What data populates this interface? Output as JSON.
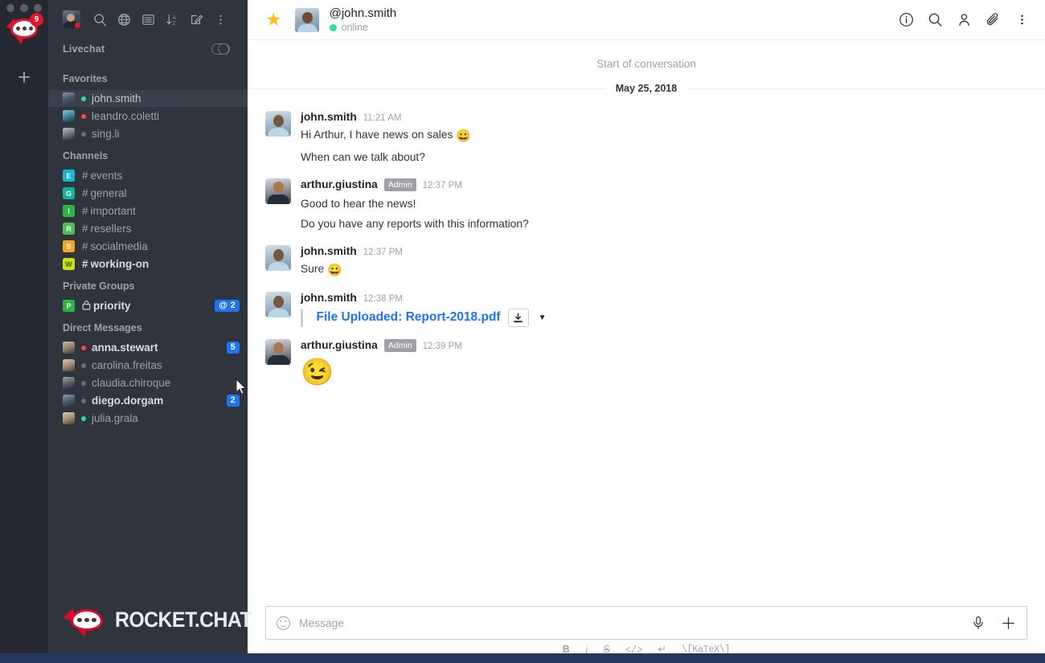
{
  "rail": {
    "app_badge": "9",
    "add_label": "+",
    "traffic_lights": [
      "close",
      "minimize",
      "zoom"
    ]
  },
  "sidebar": {
    "toolbar": [
      {
        "name": "user-avatar",
        "label": "avatar"
      },
      {
        "name": "search-icon",
        "label": "Search"
      },
      {
        "name": "globe-icon",
        "label": "Directory"
      },
      {
        "name": "list-icon",
        "label": "Discussions"
      },
      {
        "name": "sort-az-icon",
        "label": "Sort"
      },
      {
        "name": "pencil-icon",
        "label": "Create new"
      },
      {
        "name": "kebab-menu-icon",
        "label": "Options"
      }
    ],
    "livechat": {
      "label": "Livechat",
      "toggle_on": true
    },
    "sections": [
      {
        "title": "Favorites",
        "items": [
          {
            "name": "john.smith",
            "type": "dm",
            "status": "green",
            "active": true,
            "badge": "",
            "avatar": "ph1"
          },
          {
            "name": "leandro.coletti",
            "type": "dm",
            "status": "red",
            "active": false,
            "badge": "",
            "avatar": "ph2"
          },
          {
            "name": "sing.li",
            "type": "dm",
            "status": "grey",
            "active": false,
            "badge": "",
            "avatar": "ph3"
          }
        ]
      },
      {
        "title": "Channels",
        "items": [
          {
            "name": "events",
            "type": "channel",
            "initial": "E",
            "color": "#13b9cf",
            "badge": "",
            "bold": false
          },
          {
            "name": "general",
            "type": "channel",
            "initial": "G",
            "color": "#13b599",
            "badge": "",
            "bold": false
          },
          {
            "name": "important",
            "type": "channel",
            "initial": "I",
            "color": "#2fb344",
            "badge": "",
            "bold": false
          },
          {
            "name": "resellers",
            "type": "channel",
            "initial": "R",
            "color": "#4fc04f",
            "badge": "",
            "bold": false
          },
          {
            "name": "socialmedia",
            "type": "channel",
            "initial": "S",
            "color": "#f5a623",
            "badge": "",
            "bold": false
          },
          {
            "name": "working-on",
            "type": "channel",
            "initial": "W",
            "color": "#c6e411",
            "badge": "",
            "bold": true
          }
        ]
      },
      {
        "title": "Private Groups",
        "items": [
          {
            "name": "priority",
            "type": "group",
            "initial": "P",
            "color": "#2fb344",
            "badge": "@ 2",
            "bold": true
          }
        ]
      },
      {
        "title": "Direct Messages",
        "items": [
          {
            "name": "anna.stewart",
            "type": "dm",
            "status": "red",
            "badge": "5",
            "bold": true,
            "avatar": "ph4"
          },
          {
            "name": "carolina.freitas",
            "type": "dm",
            "status": "grey",
            "badge": "",
            "bold": false,
            "avatar": "ph5"
          },
          {
            "name": "claudia.chiroque",
            "type": "dm",
            "status": "grey",
            "badge": "",
            "bold": false,
            "avatar": "ph6"
          },
          {
            "name": "diego.dorgam",
            "type": "dm",
            "status": "grey",
            "badge": "2",
            "bold": true,
            "avatar": "ph7"
          },
          {
            "name": "julia.grala",
            "type": "dm",
            "status": "green",
            "badge": "",
            "bold": false,
            "avatar": "ph8"
          }
        ]
      }
    ],
    "logo_text": "ROCKET.CHAT"
  },
  "chat": {
    "header": {
      "favorite_icon": "star-icon",
      "title": "@john.smith",
      "status": "online",
      "status_color": "#2de0a5",
      "actions": [
        {
          "name": "info-icon",
          "label": "Info"
        },
        {
          "name": "search-icon",
          "label": "Search Messages"
        },
        {
          "name": "members-icon",
          "label": "Members"
        },
        {
          "name": "attachment-icon",
          "label": "Files"
        },
        {
          "name": "kebab-menu-icon",
          "label": "Options"
        }
      ]
    },
    "start_of_conversation": "Start of conversation",
    "date_divider": "May 25, 2018",
    "messages": [
      {
        "user": "john.smith",
        "avatar": "av-john",
        "role": "",
        "time": "11:21 AM",
        "lines": [
          {
            "text": "Hi Arthur, I have news on sales ",
            "emoji": "😀"
          },
          {
            "text": "When can we talk about?",
            "emoji": ""
          }
        ]
      },
      {
        "user": "arthur.giustina",
        "avatar": "av-arthur",
        "role": "Admin",
        "time": "12:37 PM",
        "lines": [
          {
            "text": "Good to hear the news!",
            "emoji": ""
          },
          {
            "text": "Do you have any reports with this information?",
            "emoji": ""
          }
        ]
      },
      {
        "user": "john.smith",
        "avatar": "av-john",
        "role": "",
        "time": "12:37 PM",
        "lines": [
          {
            "text": "Sure ",
            "emoji": "😀"
          }
        ]
      }
    ],
    "file_message": {
      "user": "john.smith",
      "avatar": "av-john",
      "time": "12:38 PM",
      "link_text": "File Uploaded: Report-2018.pdf",
      "download_icon": "download-icon",
      "caret_icon": "chevron-down-icon",
      "link_color": "#1d74f5"
    },
    "emoji_message": {
      "user": "arthur.giustina",
      "avatar": "av-arthur",
      "role": "Admin",
      "time": "12:39 PM",
      "emoji": "😉"
    }
  },
  "composer": {
    "emoji_icon": "smiley-icon",
    "placeholder": "Message",
    "value": "",
    "mic_icon": "microphone-icon",
    "plus_icon": "plus-icon",
    "format_buttons": [
      {
        "name": "bold-button",
        "label": "B"
      },
      {
        "name": "italic-button",
        "label": "i"
      },
      {
        "name": "strike-button",
        "label": "S"
      },
      {
        "name": "code-button",
        "label": "</>"
      },
      {
        "name": "multiline-button",
        "label": "↵"
      },
      {
        "name": "katex-button",
        "label": "\\[KaTeX\\]"
      }
    ]
  }
}
